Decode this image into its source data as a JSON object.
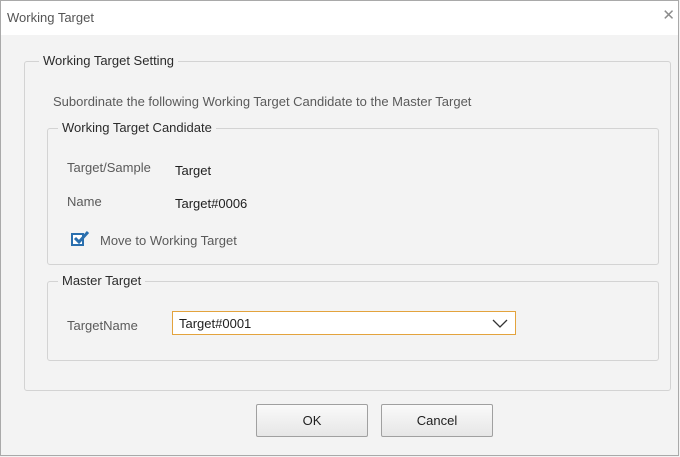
{
  "window": {
    "title": "Working Target",
    "close_icon": "close-icon"
  },
  "setting_group": {
    "legend": "Working Target Setting",
    "instruction": "Subordinate the following Working Target Candidate to the Master Target"
  },
  "candidate_group": {
    "legend": "Working Target Candidate",
    "target_sample_label": "Target/Sample",
    "target_sample_value": "Target",
    "name_label": "Name",
    "name_value": "Target#0006",
    "move_checkbox": {
      "label": "Move to Working Target",
      "checked": true
    }
  },
  "master_group": {
    "legend": "Master Target",
    "target_name_label": "TargetName",
    "target_name_selected": "Target#0001"
  },
  "buttons": {
    "ok": "OK",
    "cancel": "Cancel"
  },
  "colors": {
    "accent_border": "#e3a33d",
    "checkbox": "#2a6fae"
  }
}
